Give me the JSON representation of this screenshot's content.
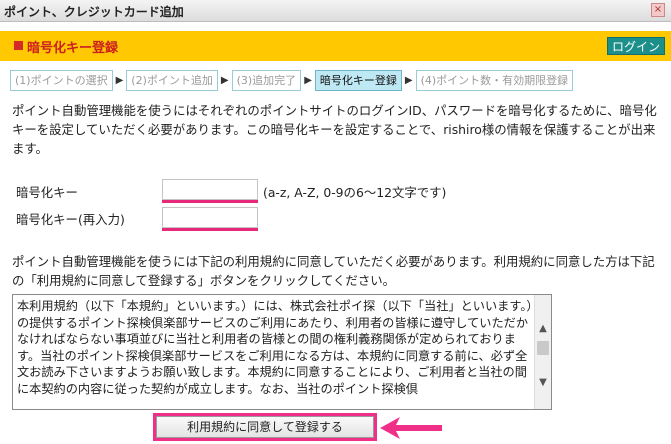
{
  "window": {
    "title": "ポイント、クレジットカード追加",
    "close_glyph": "×"
  },
  "header": {
    "title": "暗号化キー登録",
    "login_button": "ログイン",
    "accent_color": "#ffc800",
    "title_color": "#cc1f1f"
  },
  "steps": [
    {
      "label": "(1)ポイントの選択",
      "active": false
    },
    {
      "label": "(2)ポイント追加",
      "active": false
    },
    {
      "label": "(3)追加完了",
      "active": false
    },
    {
      "label": "暗号化キー登録",
      "active": true
    },
    {
      "label": "(4)ポイント数・有効期限登録",
      "active": false
    }
  ],
  "step_separator": "▶",
  "intro_text": "ポイント自動管理機能を使うにはそれぞれのポイントサイトのログインID、パスワードを暗号化するために、暗号化キーを設定していただく必要があります。この暗号化キーを設定することで、rishiro様の情報を保護することが出来ます。",
  "form": {
    "key_label": "暗号化キー",
    "key_value": "",
    "key_hint": "(a-z, A-Z, 0-9の6～12文字です)",
    "key_confirm_label": "暗号化キー(再入力)",
    "key_confirm_value": ""
  },
  "agree_note": "ポイント自動管理機能を使うには下記の利用規約に同意していただく必要があります。利用規約に同意した方は下記の「利用規約に同意して登録する」ボタンをクリックしてください。",
  "terms_text": "本利用規約（以下「本規約」といいます。）には、株式会社ポイ探（以下「当社」といいます。）の提供するポイント探検倶楽部サービスのご利用にあたり、利用者の皆様に遵守していただかなければならない事項並びに当社と利用者の皆様との間の権利義務関係が定められております。当社のポイント探検倶楽部サービスをご利用になる方は、本規約に同意する前に、必ず全文お読み下さいますようお願い致します。本規約に同意することにより、ご利用者と当社の間に本契約の内容に従った契約が成立します。なお、当社のポイント探検倶",
  "agree_button": "利用規約に同意して登録する",
  "highlight_color": "#ef2f88"
}
